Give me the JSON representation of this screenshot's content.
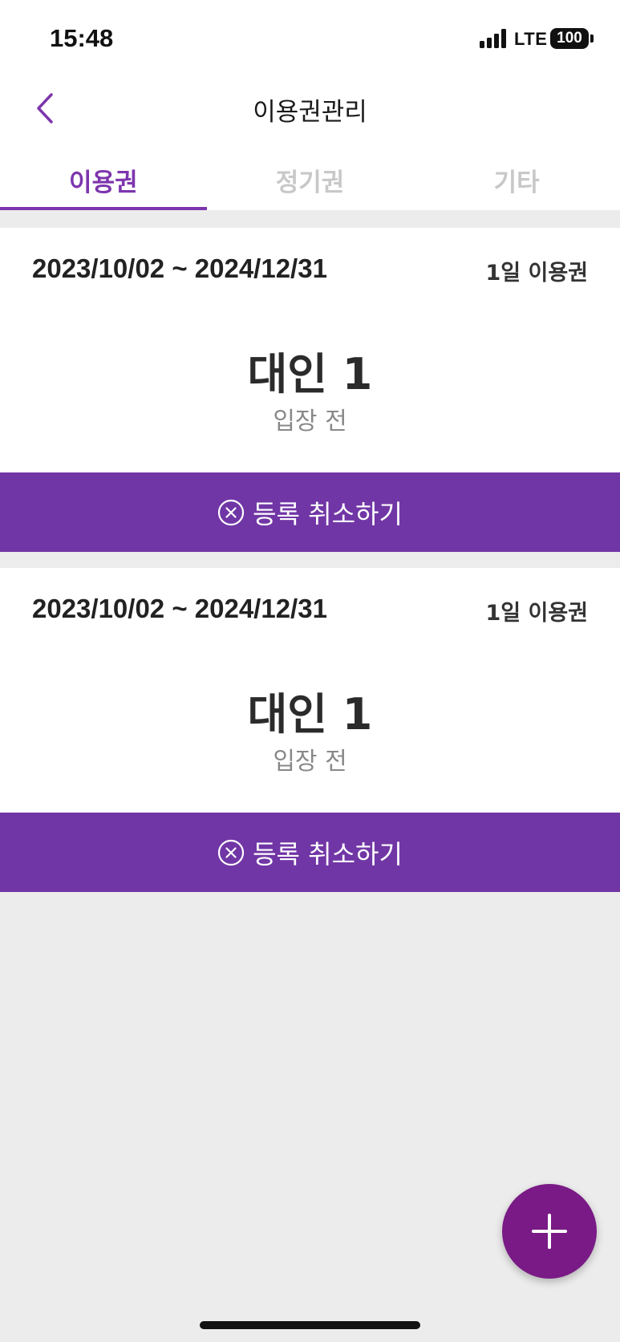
{
  "status_bar": {
    "time": "15:48",
    "network": "LTE",
    "battery": "100"
  },
  "header": {
    "title": "이용권관리",
    "back_icon": "chevron-left-icon"
  },
  "tabs": [
    {
      "label": "이용권",
      "active": true
    },
    {
      "label": "정기권",
      "active": false
    },
    {
      "label": "기타",
      "active": false
    }
  ],
  "tickets": [
    {
      "dates": "2023/10/02 ~ 2024/12/31",
      "type": "1일 이용권",
      "person": "대인 1",
      "status": "입장 전",
      "cancel_label": "등록 취소하기"
    },
    {
      "dates": "2023/10/02 ~ 2024/12/31",
      "type": "1일 이용권",
      "person": "대인 1",
      "status": "입장 전",
      "cancel_label": "등록 취소하기"
    }
  ],
  "fab": {
    "icon": "plus-icon"
  },
  "colors": {
    "accent": "#7d35ad",
    "button": "#7136a6",
    "fab": "#7a1a86",
    "background": "#ececec"
  }
}
